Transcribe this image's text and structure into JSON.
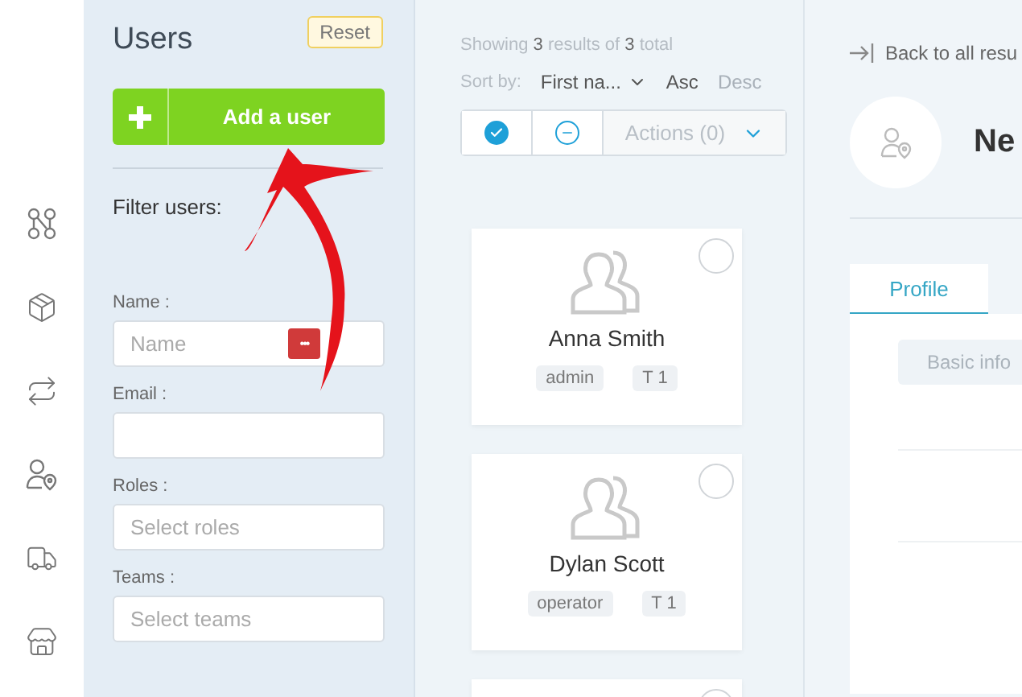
{
  "nav_rail": {
    "items": [
      {
        "kind": "nodes"
      },
      {
        "kind": "box"
      },
      {
        "kind": "repeat"
      },
      {
        "kind": "user-pin"
      },
      {
        "kind": "truck"
      },
      {
        "kind": "store"
      }
    ]
  },
  "filter_panel": {
    "title": "Users",
    "reset_button": "Reset",
    "add_button": "Add a user",
    "heading": "Filter users:",
    "fields": [
      {
        "label": "Name :",
        "placeholder": "Name",
        "badge": "•••"
      },
      {
        "label": "Email :"
      },
      {
        "label": "Roles :",
        "placeholder": "Select roles"
      },
      {
        "label": "Teams :",
        "placeholder": "Select teams"
      }
    ]
  },
  "annotation": {
    "kind": "arrow"
  },
  "results": {
    "summary": "Showing **3** results of **3** total",
    "sort_label": "Sort by:",
    "sort_field": "First na...",
    "sort_orders": [
      {
        "label": "Asc",
        "selected": true
      },
      {
        "label": "Desc",
        "selected": false
      }
    ],
    "select_all": {
      "checked": true
    },
    "actions": {
      "label": "Actions (0)",
      "disabled": true
    },
    "users": [
      {
        "name": "Anna Smith",
        "tags": [
          "admin",
          "T 1"
        ],
        "selected": false
      },
      {
        "name": "Dylan Scott",
        "tags": [
          "operator",
          "T 1"
        ],
        "selected": false
      },
      {
        "selected": false
      }
    ]
  },
  "detail": {
    "back_link": "Back to all resu",
    "title": "Ne",
    "tabs": [
      {
        "label": "Profile",
        "selected": true
      }
    ],
    "section": "Basic info"
  }
}
